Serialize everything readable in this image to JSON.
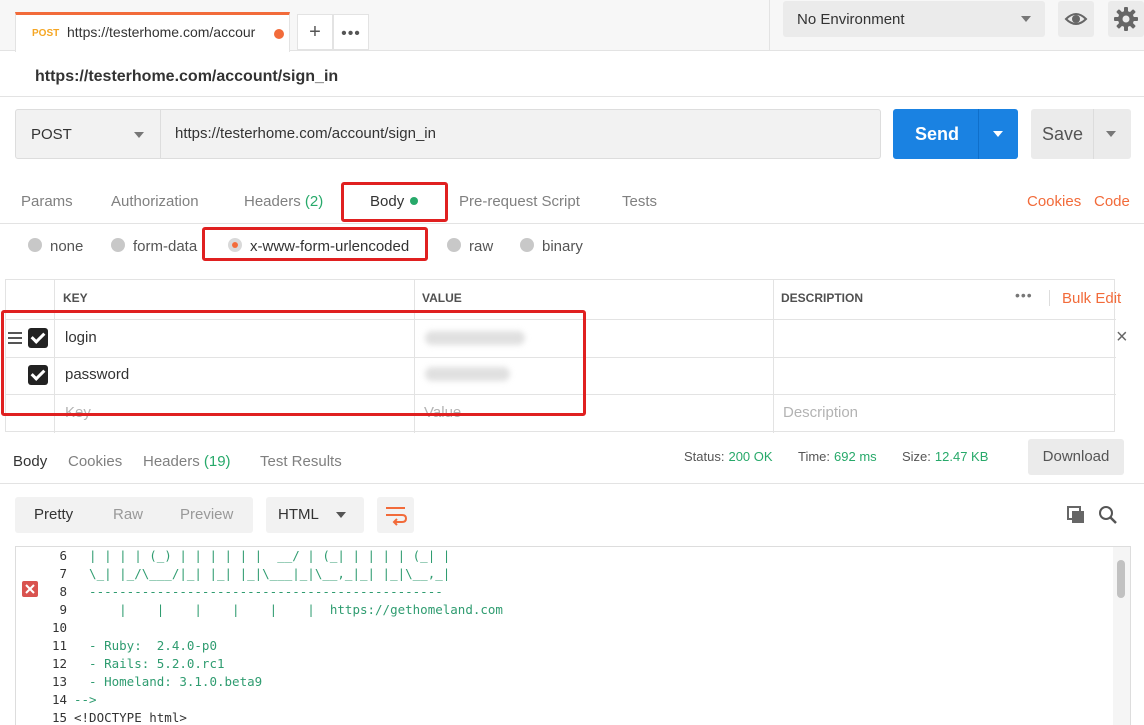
{
  "request_tab": {
    "method": "POST",
    "url": "https://testerhome.com/accour"
  },
  "environment": {
    "selected": "No Environment"
  },
  "request_name": "https://testerhome.com/account/sign_in",
  "url_bar": {
    "method": "POST",
    "url": "https://testerhome.com/account/sign_in",
    "send_label": "Send",
    "save_label": "Save"
  },
  "request_tabs": {
    "params": "Params",
    "authorization": "Authorization",
    "headers": "Headers",
    "headers_count": "(2)",
    "body": "Body",
    "prerequest": "Pre-request Script",
    "tests": "Tests",
    "cookies": "Cookies",
    "code": "Code"
  },
  "body_modes": {
    "none": "none",
    "form_data": "form-data",
    "urlencoded": "x-www-form-urlencoded",
    "raw": "raw",
    "binary": "binary",
    "selected": "x-www-form-urlencoded"
  },
  "kv_table": {
    "headers": {
      "key": "KEY",
      "value": "VALUE",
      "description": "DESCRIPTION"
    },
    "bulk_edit": "Bulk Edit",
    "rows": [
      {
        "key": "login",
        "checked": true
      },
      {
        "key": "password",
        "checked": true
      }
    ],
    "placeholders": {
      "key": "Key",
      "value": "Value",
      "description": "Description"
    }
  },
  "response_tabs": {
    "body": "Body",
    "cookies": "Cookies",
    "headers": "Headers",
    "headers_count": "(19)",
    "test_results": "Test Results"
  },
  "response_status": {
    "status_label": "Status:",
    "status_value": "200 OK",
    "time_label": "Time:",
    "time_value": "692 ms",
    "size_label": "Size:",
    "size_value": "12.47 KB",
    "download_label": "Download"
  },
  "view_bar": {
    "pretty": "Pretty",
    "raw": "Raw",
    "preview": "Preview",
    "format": "HTML"
  },
  "code_lines": [
    {
      "n": "6",
      "text": "  | | | | (_) | | | | | |  __/ | (_| | | | | (_| |",
      "kind": "comment"
    },
    {
      "n": "7",
      "text": "  \\_| |_/\\___/|_| |_| |_|\\___|_|\\__,_|_| |_|\\__,_|",
      "kind": "comment"
    },
    {
      "n": "8",
      "text": "  -----------------------------------------------",
      "kind": "comment"
    },
    {
      "n": "9",
      "text": "      |    |    |    |    |    |  https://gethomeland.com",
      "kind": "comment"
    },
    {
      "n": "10",
      "text": "",
      "kind": "comment"
    },
    {
      "n": "11",
      "text": "  - Ruby:  2.4.0-p0",
      "kind": "comment"
    },
    {
      "n": "12",
      "text": "  - Rails: 5.2.0.rc1",
      "kind": "comment"
    },
    {
      "n": "13",
      "text": "  - Homeland: 3.1.0.beta9",
      "kind": "comment"
    },
    {
      "n": "14",
      "text": "-->",
      "kind": "comment"
    },
    {
      "n": "15",
      "text": "<!DOCTYPE html>",
      "kind": "plain"
    }
  ],
  "colors": {
    "accent_orange": "#f26b3a",
    "send_blue": "#1a82e2",
    "green": "#27a96a",
    "highlight_red": "#e02020"
  }
}
